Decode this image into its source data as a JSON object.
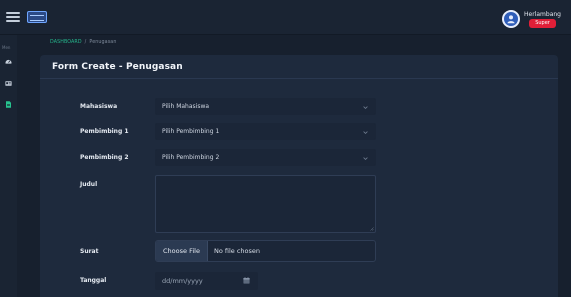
{
  "topbar": {
    "menu_icon": "hamburger-icon",
    "logo_icon": "app-logo"
  },
  "user": {
    "name": "Herlambang",
    "role": "Super",
    "avatar_icon": "user-avatar-icon"
  },
  "sidebar": {
    "label": "Men",
    "items": [
      {
        "icon": "gauge-icon"
      },
      {
        "icon": "id-card-icon"
      },
      {
        "icon": "document-icon",
        "active": true
      }
    ]
  },
  "breadcrumb": {
    "root": "DASHBOARD",
    "separator": "/",
    "current": "Penugasan"
  },
  "form": {
    "title": "Form Create - Penugasan",
    "mahasiswa": {
      "label": "Mahasiswa",
      "value": "Pilih Mahasiswa"
    },
    "pembimbing1": {
      "label": "Pembimbing 1",
      "value": "Pilih Pembimbing 1"
    },
    "pembimbing2": {
      "label": "Pembimbing 2",
      "value": "Pilih Pembimbing 2"
    },
    "judul": {
      "label": "Judul",
      "value": ""
    },
    "surat": {
      "label": "Surat",
      "button": "Choose File",
      "status": "No file chosen"
    },
    "tanggal": {
      "label": "Tanggal",
      "placeholder": "dd/mm/yyyy"
    }
  },
  "colors": {
    "background": "#17202e",
    "card": "#1e2a3d",
    "accent_green": "#25b58b",
    "badge_red": "#e01f38",
    "avatar_blue": "#2f5db8"
  }
}
